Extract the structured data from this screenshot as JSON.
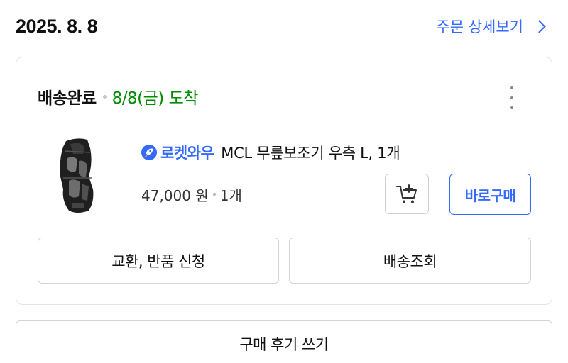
{
  "order": {
    "date": "2025. 8. 8",
    "detail_link_label": "주문 상세보기"
  },
  "status": {
    "label": "배송완료",
    "arrival": "8/8(금) 도착"
  },
  "product": {
    "delivery_badge": "로켓와우",
    "name": "MCL 무릎보조기 우측 L, 1개",
    "price": "47,000 원",
    "quantity": "1개"
  },
  "actions": {
    "buy_now_label": "바로구매",
    "exchange_label": "교환, 반품 신청",
    "tracking_label": "배송조회",
    "review_label": "구매 후기 쓰기"
  },
  "icons": {
    "more": "more-vertical-icon",
    "chevron": "chevron-right-icon",
    "rocket": "rocket-icon",
    "cart": "add-to-cart-icon"
  },
  "colors": {
    "accent": "#346aff",
    "arrival_green": "#008c00",
    "border": "#e3e3e3"
  }
}
